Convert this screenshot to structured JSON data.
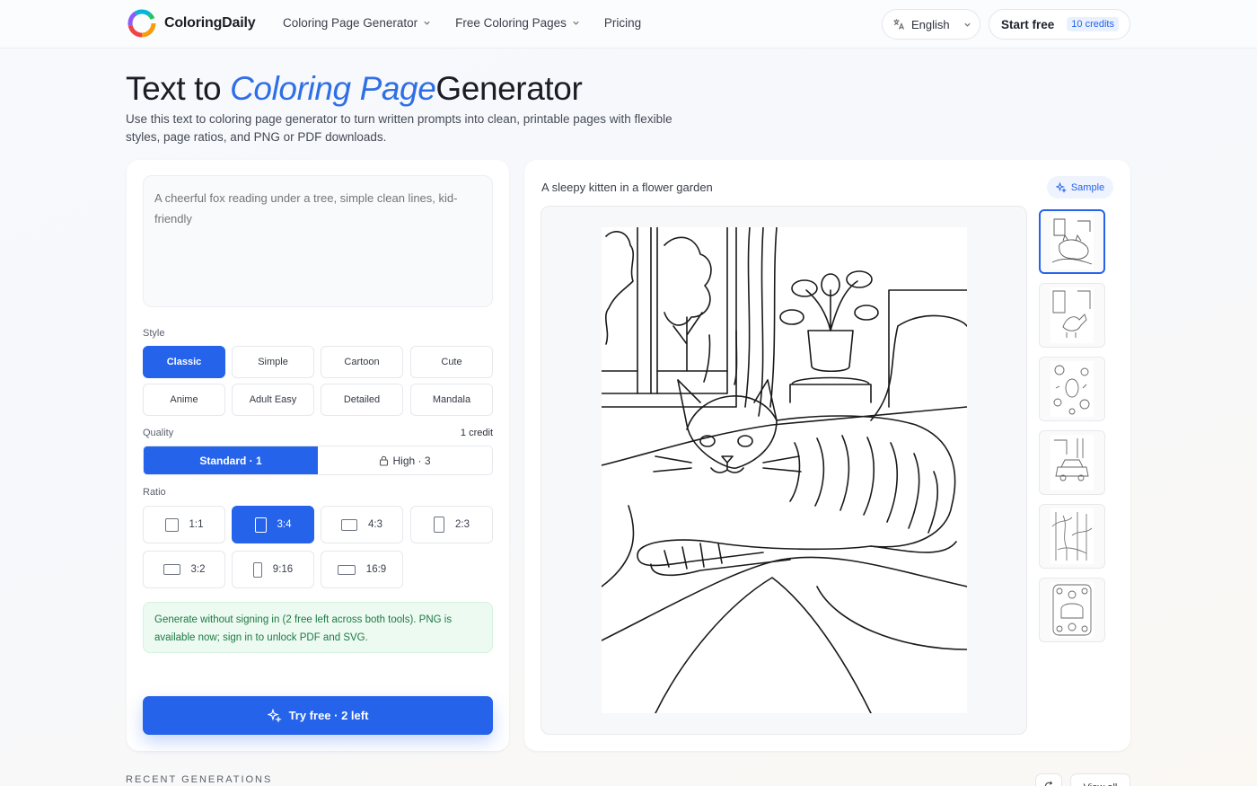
{
  "header": {
    "brand": "ColoringDaily",
    "nav": [
      {
        "label": "Coloring Page Generator",
        "has_dropdown": true
      },
      {
        "label": "Free Coloring Pages",
        "has_dropdown": true
      },
      {
        "label": "Pricing",
        "has_dropdown": false
      }
    ],
    "language": "English",
    "start_label": "Start free",
    "credits": "10 credits"
  },
  "hero": {
    "title_before": "Text to",
    "title_accent": "Coloring Page",
    "title_after": "Generator",
    "subtitle": "Use this text to coloring page generator to turn written prompts into clean, printable pages with flexible styles, page ratios, and PNG or PDF downloads."
  },
  "form": {
    "prompt_value": "",
    "prompt_placeholder": "A cheerful fox reading under a tree, simple clean lines, kid-friendly",
    "style_label": "Style",
    "styles": [
      "Classic",
      "Simple",
      "Cartoon",
      "Cute",
      "Anime",
      "Adult Easy",
      "Detailed",
      "Mandala"
    ],
    "selected_style": "Classic",
    "quality_label": "Quality",
    "quality_cost": "1 credit",
    "quality_options": [
      "Standard · 1",
      "High · 3"
    ],
    "selected_quality": "Standard · 1",
    "ratio_label": "Ratio",
    "ratios": [
      "1:1",
      "3:4",
      "4:3",
      "2:3",
      "3:2",
      "9:16",
      "16:9"
    ],
    "selected_ratio": "3:4",
    "notice": "Generate without signing in (2 free left across both tools). PNG is available now; sign in to unlock PDF and SVG.",
    "cta_label": "Try free · 2 left"
  },
  "preview": {
    "caption": "A sleepy kitten in a flower garden",
    "sample_label": "Sample",
    "thumbnails": [
      "cat-on-bed",
      "dinosaur-scene",
      "space-doodles",
      "vehicle-scene",
      "forest-scene",
      "mandala-cake"
    ],
    "selected_thumbnail": 0
  },
  "recent": {
    "label": "RECENT GENERATIONS",
    "view_all": "View all"
  },
  "colors": {
    "accent": "#2563eb",
    "notice_bg": "#edfaf1",
    "notice_text": "#1c7a43"
  },
  "icons": [
    "logo-mark",
    "translate-icon",
    "chevron-down-icon",
    "sparkle-icon",
    "lock-icon",
    "refresh-icon"
  ]
}
